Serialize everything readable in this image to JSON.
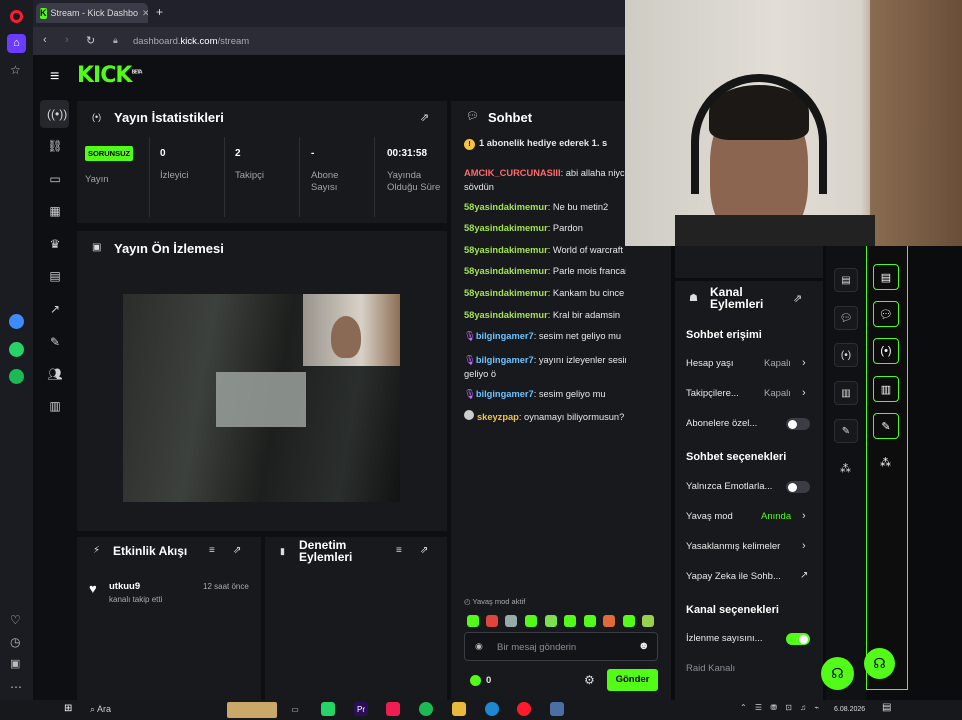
{
  "browser": {
    "tab_title": "Stream - Kick Dashbo",
    "url_prefix": "dashboard.",
    "url_host": "kick.com",
    "url_path": "/stream"
  },
  "app": {
    "logo": "KICK",
    "logo_sup": "BETA"
  },
  "stats": {
    "title": "Yayın İstatistikleri",
    "status_badge": "SORUNSUZ",
    "stream_label": "Yayın",
    "cols": [
      {
        "value": "0",
        "label": "İzleyici"
      },
      {
        "value": "2",
        "label": "Takipçi"
      },
      {
        "value": "-",
        "label": "Abone Sayısı"
      },
      {
        "value": "00:31:58",
        "label": "Yayında Olduğu Süre"
      }
    ]
  },
  "preview": {
    "title": "Yayın Ön İzlemesi"
  },
  "activity": {
    "title": "Etkinlik Akışı",
    "items": [
      {
        "user": "utkuu9",
        "text": "kanalı takip etti",
        "time": "12 saat önce"
      }
    ]
  },
  "moderation": {
    "title": "Denetim Eylemleri"
  },
  "chat": {
    "title": "Sohbet",
    "pinned": "1 abonelik hediye ederek 1. s",
    "messages": [
      {
        "user": "AMCIK_CURCUNASIII",
        "text": ": abi allaha niyc",
        "text2": "sövdün",
        "style": "u1"
      },
      {
        "user": "58yasindakimemur",
        "text": ": Ne bu metin2",
        "style": "u2"
      },
      {
        "user": "58yasindakimemur",
        "text": ": Pardon",
        "style": "u2"
      },
      {
        "user": "58yasindakimemur",
        "text": ": World of warcraft mis",
        "style": "u2"
      },
      {
        "user": "58yasindakimemur",
        "text": ": Parle mois francais ?",
        "style": "u2"
      },
      {
        "user": "58yasindakimemur",
        "text": ": Kankam bu cince",
        "style": "u2"
      },
      {
        "user": "58yasindakimemur",
        "text": ": Kral bir adamsin",
        "style": "u2"
      },
      {
        "user": "bilgingamer7",
        "text": ": sesim net geliyo mu",
        "style": "u3"
      },
      {
        "user": "bilgingamer7",
        "text": ": yayını izleyenler sesim",
        "text2": "geliyo ö",
        "style": "u3"
      },
      {
        "user": "bilgingamer7",
        "text": ": sesim geliyo mu",
        "style": "u3"
      },
      {
        "user": "skeyzpap",
        "text": ": oynamayı biliyormusun?",
        "style": "u4"
      }
    ],
    "slow_mode": "Yavaş mod aktif",
    "input_placeholder": "Bir mesaj gönderin",
    "points": "0",
    "send": "Gönder"
  },
  "actions": {
    "title": "Kanal Eylemleri",
    "sec1": "Sohbet erişimi",
    "account_age": "Hesap yaşı",
    "account_age_val": "Kapalı",
    "followers": "Takipçilere...",
    "followers_val": "Kapalı",
    "subs_only": "Abonelere özel...",
    "sec2": "Sohbet seçenekleri",
    "emotes_only": "Yalnızca Emotlarla...",
    "slow": "Yavaş mod",
    "slow_val": "Anında",
    "banned_words": "Yasaklanmış kelimeler",
    "ai": "Yapay Zeka ile Sohb...",
    "sec3": "Kanal seçenekleri",
    "viewer_count": "İzlenme sayısını...",
    "raid": "Raid Kanalı"
  },
  "taskbar": {
    "search": "Ara",
    "date": "6.08.2026"
  },
  "colors": {
    "accent": "#53fc18",
    "bg": "#0e0f12",
    "panel": "#17191d"
  }
}
